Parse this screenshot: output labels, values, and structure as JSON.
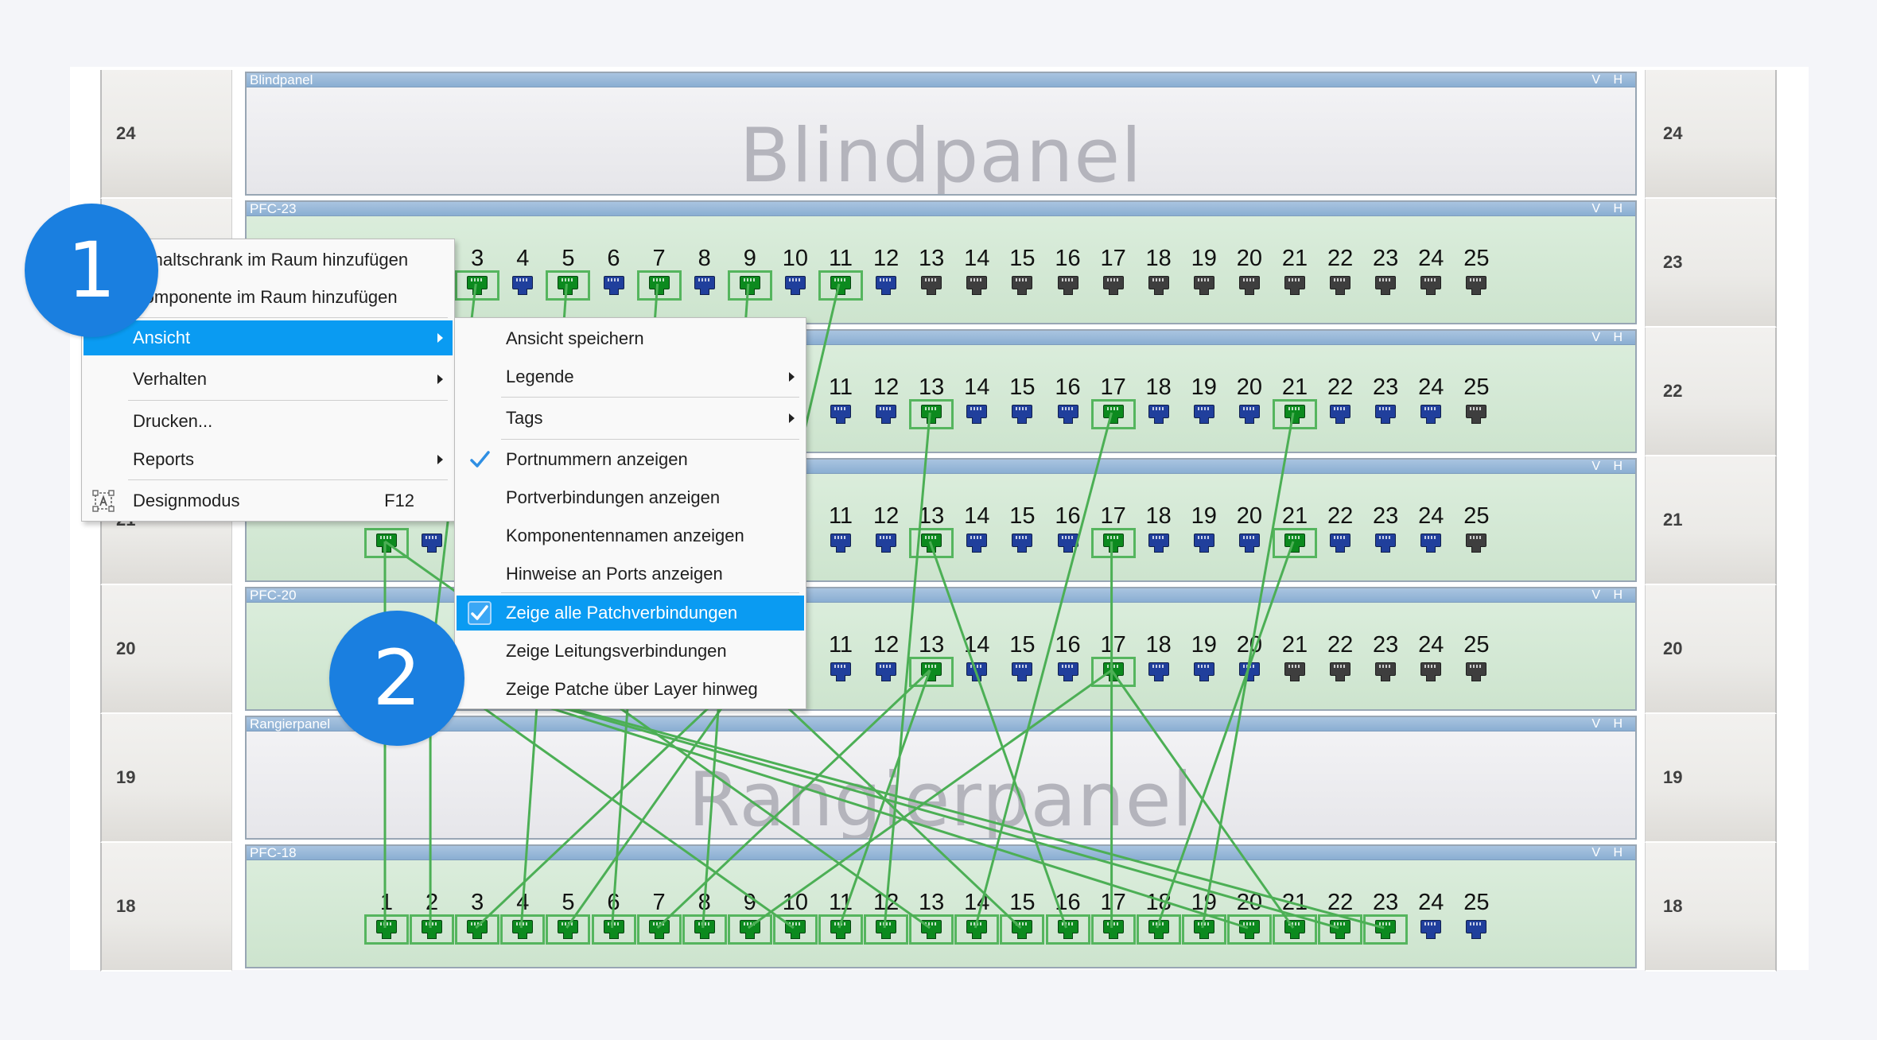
{
  "panels": [
    {
      "unit": "24",
      "name": "Blindpanel",
      "vh": "V H",
      "kind": "blind",
      "big_label": "Blindpanel"
    },
    {
      "unit": "23",
      "name": "PFC-23",
      "vh": "V H",
      "kind": "patch",
      "first_port": 3,
      "ports": {
        "3": "g",
        "4": "b",
        "5": "g",
        "6": "b",
        "7": "g",
        "8": "b",
        "9": "g",
        "10": "b",
        "11": "g",
        "12": "b",
        "13": "k",
        "14": "k",
        "15": "k",
        "16": "k",
        "17": "k",
        "18": "k",
        "19": "k",
        "20": "k",
        "21": "k",
        "22": "k",
        "23": "k",
        "24": "k",
        "25": "k"
      },
      "boxed": [
        3,
        5,
        7,
        9,
        11
      ]
    },
    {
      "unit": "22",
      "name": "",
      "vh": "V H",
      "kind": "patch",
      "first_port": 11,
      "ports": {
        "11": "b",
        "12": "b",
        "13": "g",
        "14": "b",
        "15": "b",
        "16": "b",
        "17": "g",
        "18": "b",
        "19": "b",
        "20": "b",
        "21": "g",
        "22": "b",
        "23": "b",
        "24": "b",
        "25": "k"
      },
      "boxed": [
        13,
        17,
        21
      ]
    },
    {
      "unit": "21",
      "name": "",
      "vh": "V H",
      "kind": "patch",
      "first_port": 11,
      "ports": {
        "1": "g",
        "2": "b",
        "11": "b",
        "12": "b",
        "13": "g",
        "14": "b",
        "15": "b",
        "16": "b",
        "17": "g",
        "18": "b",
        "19": "b",
        "20": "b",
        "21": "g",
        "22": "b",
        "23": "b",
        "24": "b",
        "25": "k"
      },
      "boxed": [
        1,
        13,
        17,
        21
      ]
    },
    {
      "unit": "20",
      "name": "PFC-20",
      "vh": "V H",
      "kind": "patch",
      "first_port": 11,
      "ports": {
        "2": "b",
        "11": "b",
        "12": "b",
        "13": "g",
        "14": "b",
        "15": "b",
        "16": "b",
        "17": "g",
        "18": "b",
        "19": "b",
        "20": "b",
        "21": "k",
        "22": "k",
        "23": "k",
        "24": "k",
        "25": "k"
      },
      "boxed": [
        13,
        17
      ]
    },
    {
      "unit": "19",
      "name": "Rangierpanel",
      "vh": "V H",
      "kind": "blind",
      "big_label": "Rangierpanel"
    },
    {
      "unit": "18",
      "name": "PFC-18",
      "vh": "V H",
      "kind": "patch",
      "first_port": 1,
      "ports": {
        "1": "g",
        "2": "g",
        "3": "g",
        "4": "g",
        "5": "g",
        "6": "g",
        "7": "g",
        "8": "g",
        "9": "g",
        "10": "g",
        "11": "g",
        "12": "g",
        "13": "g",
        "14": "g",
        "15": "g",
        "16": "g",
        "17": "g",
        "18": "g",
        "19": "g",
        "20": "g",
        "21": "g",
        "22": "g",
        "23": "g",
        "24": "b",
        "25": "b"
      },
      "boxed": [
        1,
        2,
        3,
        4,
        5,
        6,
        7,
        8,
        9,
        10,
        11,
        12,
        13,
        14,
        15,
        16,
        17,
        18,
        19,
        20,
        21,
        22,
        23
      ]
    }
  ],
  "colors": {
    "port_green": "#0c8a1e",
    "port_blue": "#203f9c",
    "port_gray": "#3e3e3e",
    "cable": "#4caf55",
    "menu_highlight": "#0a9bf2",
    "badge": "#1a7fe0"
  },
  "context_menu": {
    "items": [
      {
        "label": "Schaltschrank im Raum hinzufügen"
      },
      {
        "label": "Komponente im Raum hinzufügen"
      },
      {
        "label": "Ansicht",
        "submenu": true,
        "highlighted": true
      },
      {
        "label": "Verhalten",
        "submenu": true
      },
      {
        "label": "Drucken..."
      },
      {
        "label": "Reports",
        "submenu": true
      },
      {
        "label": "Designmodus",
        "shortcut": "F12",
        "icon": "design-mode-icon"
      }
    ]
  },
  "submenu": {
    "items": [
      {
        "label": "Ansicht speichern"
      },
      {
        "label": "Legende",
        "submenu": true
      },
      {
        "label": "Tags",
        "submenu": true
      },
      {
        "label": "Portnummern anzeigen",
        "checked": true
      },
      {
        "label": "Portverbindungen anzeigen"
      },
      {
        "label": "Komponentennamen anzeigen"
      },
      {
        "label": "Hinweise an Ports anzeigen"
      },
      {
        "label": "Zeige alle Patchverbindungen",
        "checked": true,
        "highlighted": true
      },
      {
        "label": "Zeige Leitungsverbindungen"
      },
      {
        "label": "Zeige Patche über Layer hinweg"
      }
    ]
  },
  "badges": [
    {
      "label": "1"
    },
    {
      "label": "2"
    }
  ],
  "cables": [
    [
      "23:3",
      "20:2"
    ],
    [
      "23:5",
      "18:4"
    ],
    [
      "23:7",
      "18:6"
    ],
    [
      "23:9",
      "18:8"
    ],
    [
      "23:11",
      "20:9"
    ],
    [
      "22:13",
      "18:12"
    ],
    [
      "22:17",
      "18:14"
    ],
    [
      "22:21",
      "18:19"
    ],
    [
      "21:1",
      "18:1"
    ],
    [
      "21:1",
      "18:13"
    ],
    [
      "21:13",
      "18:16"
    ],
    [
      "21:17",
      "18:17"
    ],
    [
      "21:21",
      "18:18"
    ],
    [
      "20:2",
      "18:2"
    ],
    [
      "20:2",
      "18:23"
    ],
    [
      "20:2",
      "18:10"
    ],
    [
      "20:13",
      "18:11"
    ],
    [
      "20:17",
      "18:21"
    ],
    [
      "20:2",
      "18:20"
    ],
    [
      "20:2",
      "18:22"
    ],
    [
      "20:9",
      "18:3"
    ],
    [
      "20:9",
      "18:5"
    ],
    [
      "20:9",
      "18:15"
    ],
    [
      "20:17",
      "18:9"
    ],
    [
      "20:13",
      "18:7"
    ]
  ]
}
